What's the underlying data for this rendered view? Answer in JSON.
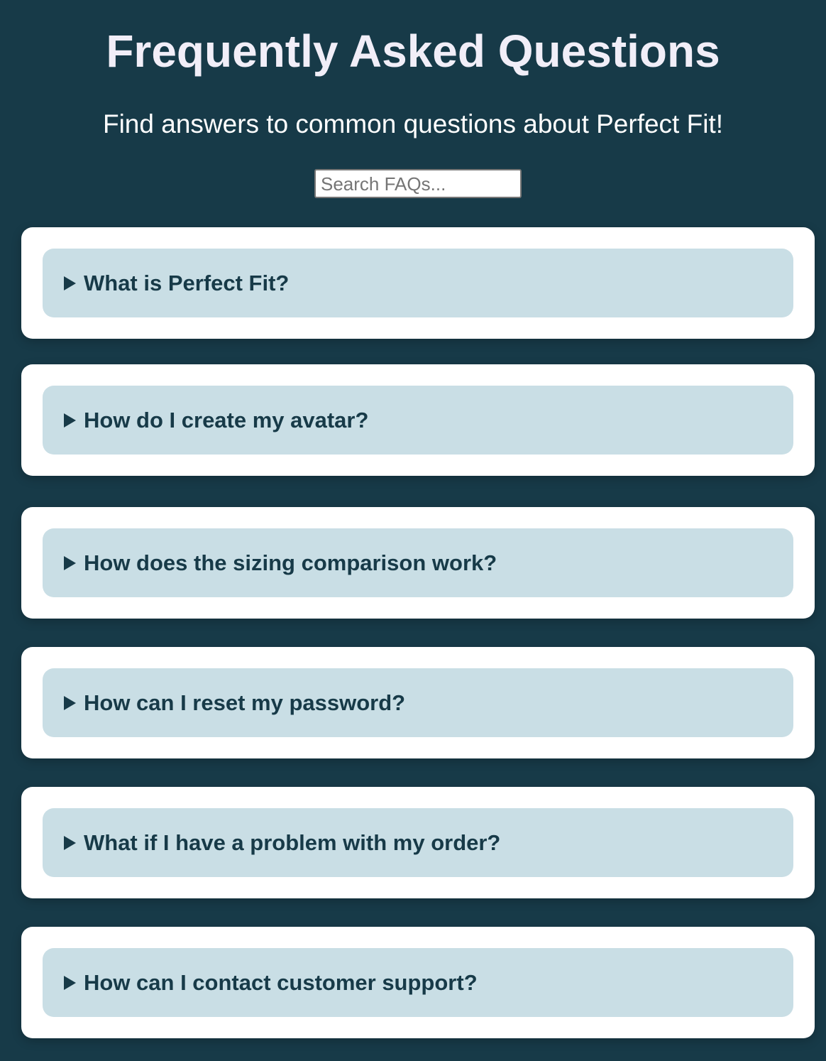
{
  "header": {
    "title": "Frequently Asked Questions",
    "subtitle": "Find answers to common questions about Perfect Fit!"
  },
  "search": {
    "placeholder": "Search FAQs...",
    "value": ""
  },
  "faqs": [
    {
      "question": "What is Perfect Fit?",
      "icon": "triangle-right-icon",
      "expanded": false
    },
    {
      "question": "How do I create my avatar?",
      "icon": "triangle-right-icon",
      "expanded": false
    },
    {
      "question": "How does the sizing comparison work?",
      "icon": "triangle-right-icon",
      "expanded": false
    },
    {
      "question": "How can I reset my password?",
      "icon": "triangle-right-icon",
      "expanded": false
    },
    {
      "question": "What if I have a problem with my order?",
      "icon": "triangle-right-icon",
      "expanded": false
    },
    {
      "question": "How can I contact customer support?",
      "icon": "triangle-right-icon",
      "expanded": false
    }
  ],
  "colors": {
    "background": "#173a48",
    "card": "#ffffff",
    "question_bg": "#c9dee5",
    "question_text": "#173a48",
    "title_text": "#f1eef8"
  }
}
